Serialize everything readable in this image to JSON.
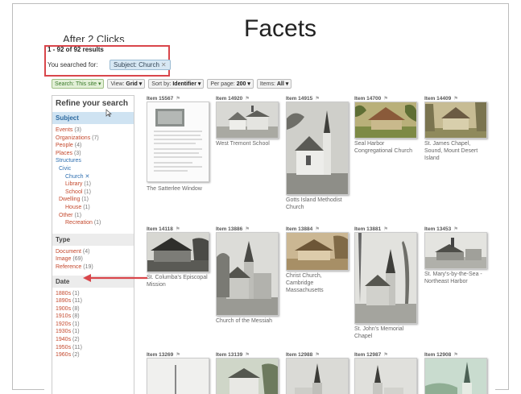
{
  "slide": {
    "title": "Facets",
    "subtitle": "After 2 Clicks"
  },
  "results": {
    "count_text": "1 - 92 of 92 results",
    "searched_label": "You searched for:",
    "chip": "Subject: Church",
    "chip_remove": "✕"
  },
  "toolbar": {
    "search_scope": "Search: This site ▾",
    "view_label": "View:",
    "view_value": "Grid ▾",
    "sort_label": "Sort by:",
    "sort_value": "Identifier ▾",
    "perpage_label": "Per page:",
    "perpage_value": "200 ▾",
    "items_label": "Items:",
    "items_value": "All ▾"
  },
  "sidebar": {
    "title": "Refine your search",
    "subject_head": "Subject",
    "subject_items": [
      {
        "label": "Events",
        "count": "(3)"
      },
      {
        "label": "Organizations",
        "count": "(7)"
      },
      {
        "label": "People",
        "count": "(4)"
      },
      {
        "label": "Places",
        "count": "(3)"
      },
      {
        "label": "Structures",
        "count": ""
      },
      {
        "label": "Civic",
        "count": ""
      },
      {
        "label": "Church ✕",
        "count": ""
      },
      {
        "label": "Library",
        "count": "(1)"
      },
      {
        "label": "School",
        "count": "(1)"
      },
      {
        "label": "Dwelling",
        "count": "(1)"
      },
      {
        "label": "House",
        "count": "(1)"
      },
      {
        "label": "Other",
        "count": "(1)"
      },
      {
        "label": "Recreation",
        "count": "(1)"
      }
    ],
    "type_head": "Type",
    "type_items": [
      {
        "label": "Document",
        "count": "(4)"
      },
      {
        "label": "Image",
        "count": "(69)"
      },
      {
        "label": "Reference",
        "count": "(19)"
      }
    ],
    "date_head": "Date",
    "date_items": [
      {
        "label": "1880s",
        "count": "(1)"
      },
      {
        "label": "1890s",
        "count": "(11)"
      },
      {
        "label": "1900s",
        "count": "(8)"
      },
      {
        "label": "1910s",
        "count": "(8)"
      },
      {
        "label": "1920s",
        "count": "(1)"
      },
      {
        "label": "1930s",
        "count": "(1)"
      },
      {
        "label": "1940s",
        "count": "(2)"
      },
      {
        "label": "1950s",
        "count": "(11)"
      },
      {
        "label": "1960s",
        "count": "(2)"
      }
    ]
  },
  "items": [
    {
      "id": "Item 15567",
      "caption": "The Satterlee Window"
    },
    {
      "id": "Item 14920",
      "caption": "West Tremont School"
    },
    {
      "id": "Item 14915",
      "caption": "Gotts Island Methodist Church"
    },
    {
      "id": "Item 14700",
      "caption": "Seal Harbor Congregational Church"
    },
    {
      "id": "Item 14409",
      "caption": "St. James Chapel, Sound, Mount Desert Island"
    },
    {
      "id": "Item 14118",
      "caption": "St. Columba's Episcopal Mission"
    },
    {
      "id": "Item 13886",
      "caption": "Church of the Messiah"
    },
    {
      "id": "Item 13884",
      "caption": "Christ Church, Cambridge Massachusetts"
    },
    {
      "id": "Item 13881",
      "caption": "St. John's Memorial Chapel"
    },
    {
      "id": "Item 13453",
      "caption": "St. Mary's-by-the-Sea - Northeast Harbor"
    },
    {
      "id": "Item 13269",
      "caption": ""
    },
    {
      "id": "Item 13139",
      "caption": ""
    },
    {
      "id": "Item 12988",
      "caption": ""
    },
    {
      "id": "Item 12987",
      "caption": ""
    },
    {
      "id": "Item 12908",
      "caption": ""
    }
  ],
  "colors": {
    "highlight_red": "#d9464b",
    "facet_link": "#c4492d",
    "active_link": "#2e6fb0"
  }
}
